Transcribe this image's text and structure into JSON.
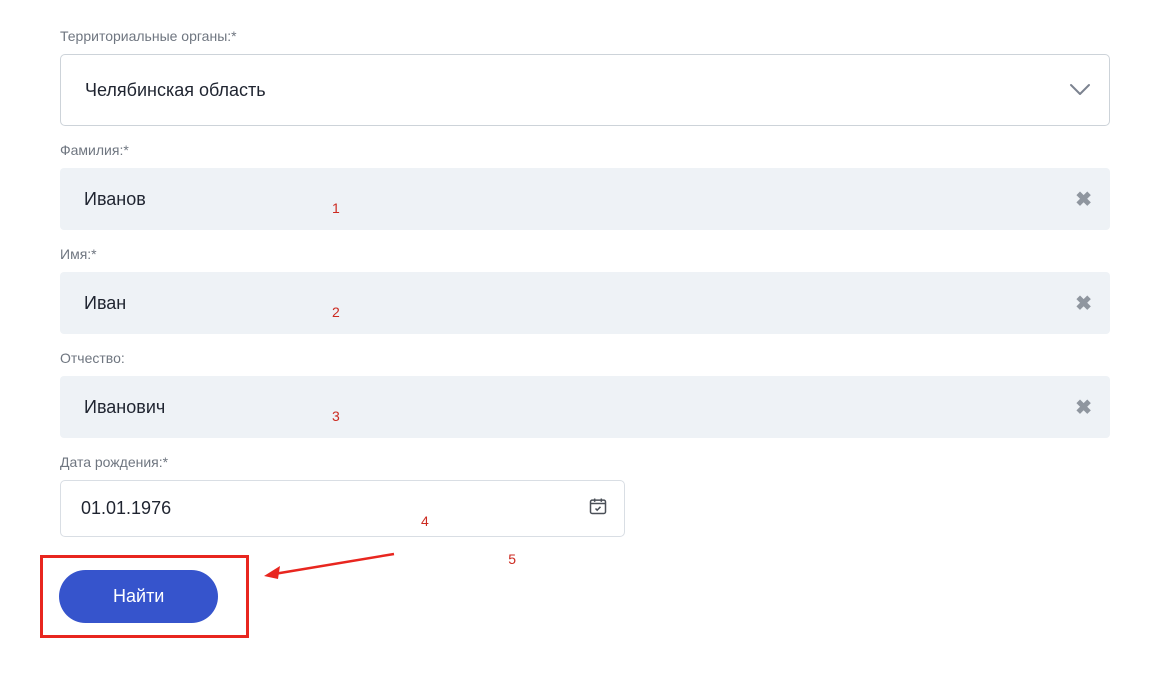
{
  "form": {
    "territorial": {
      "label": "Территориальные органы:*",
      "value": "Челябинская область"
    },
    "lastname": {
      "label": "Фамилия:*",
      "value": "Иванов"
    },
    "firstname": {
      "label": "Имя:*",
      "value": "Иван"
    },
    "patronymic": {
      "label": "Отчество:",
      "value": "Иванович"
    },
    "birthdate": {
      "label": "Дата рождения:*",
      "value": "01.01.1976"
    },
    "submit": {
      "label": "Найти"
    }
  },
  "annotations": {
    "m1": "1",
    "m2": "2",
    "m3": "3",
    "m4": "4",
    "m5": "5"
  }
}
